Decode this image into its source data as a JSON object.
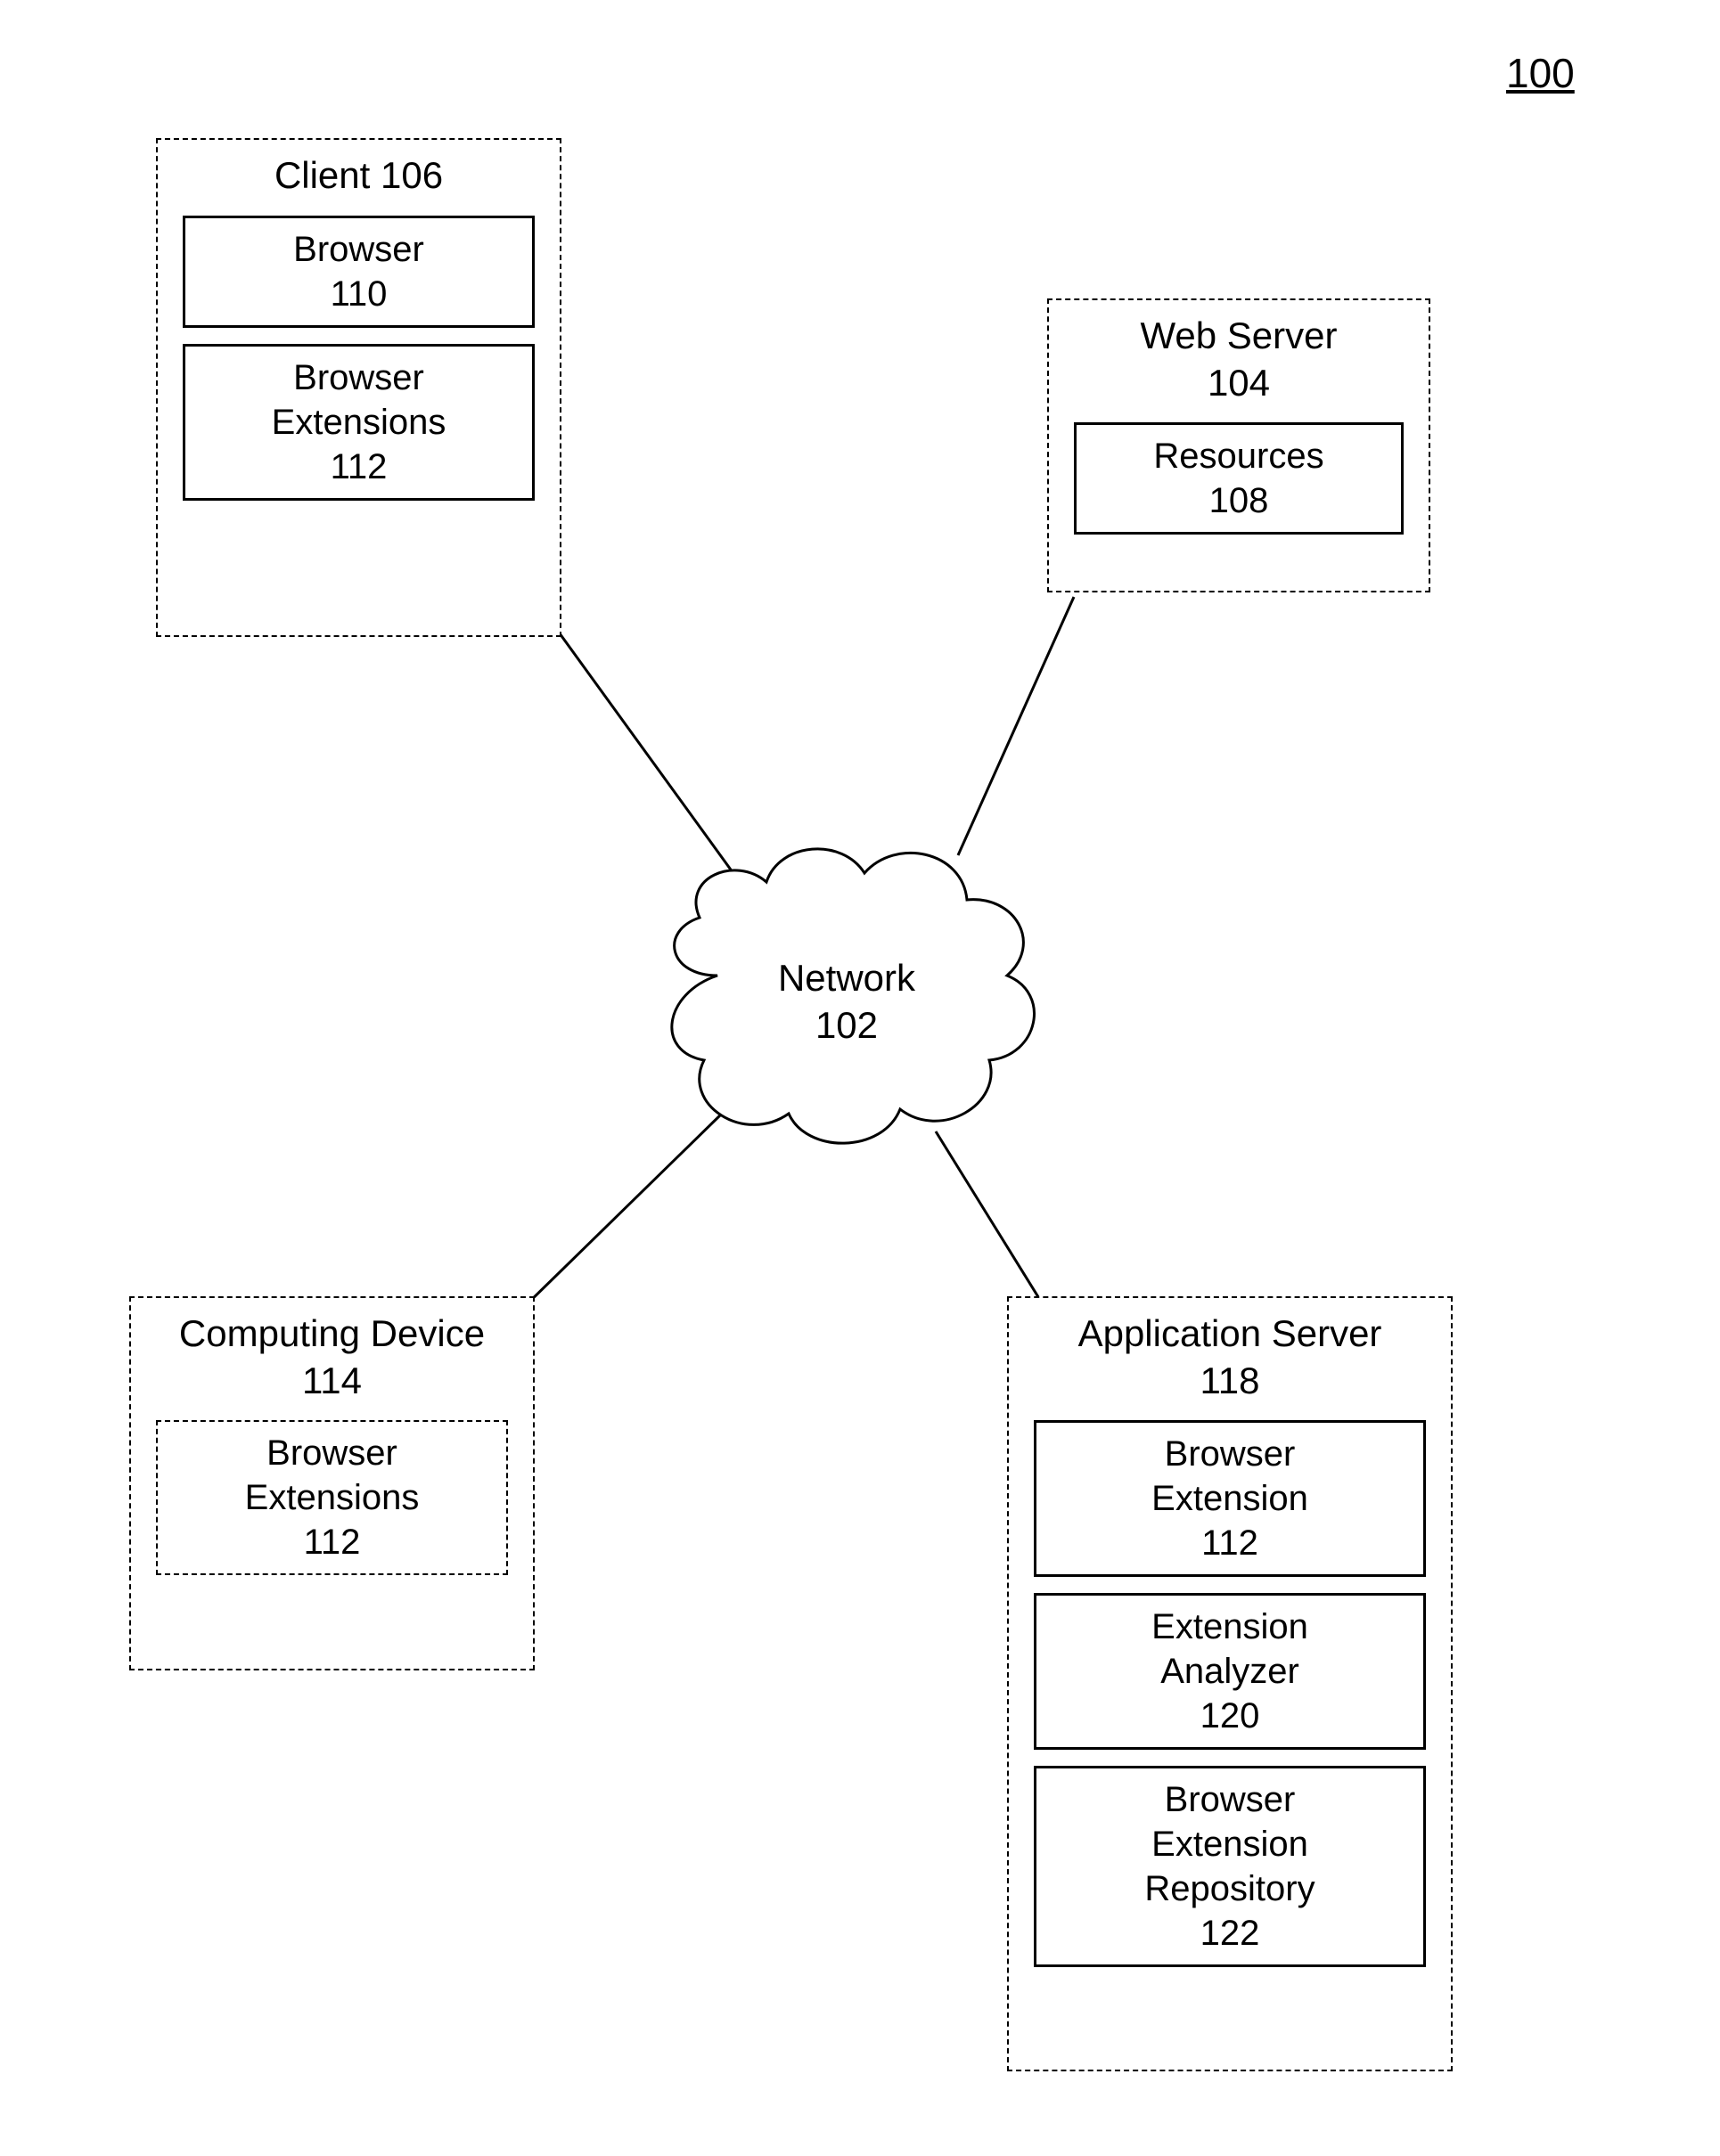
{
  "figure_label": "100",
  "network": {
    "title": "Network",
    "ref": "102"
  },
  "client": {
    "title": "Client 106",
    "browser": {
      "title": "Browser",
      "ref": "110"
    },
    "extensions": {
      "title": "Browser\nExtensions",
      "ref": "112"
    }
  },
  "web_server": {
    "title": "Web Server",
    "ref": "104",
    "resources": {
      "title": "Resources",
      "ref": "108"
    }
  },
  "computing_device": {
    "title": "Computing Device",
    "ref": "114",
    "extensions": {
      "title": "Browser\nExtensions",
      "ref": "112"
    }
  },
  "app_server": {
    "title": "Application Server",
    "ref": "118",
    "extension": {
      "title": "Browser\nExtension",
      "ref": "112"
    },
    "analyzer": {
      "title": "Extension\nAnalyzer",
      "ref": "120"
    },
    "repository": {
      "title": "Browser\nExtension\nRepository",
      "ref": "122"
    }
  }
}
